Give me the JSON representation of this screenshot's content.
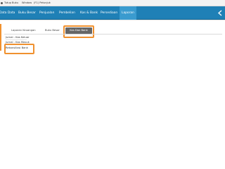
{
  "titlebar": {
    "items": [
      "Tutup Buku",
      "Window",
      "(F1) Petunjuk"
    ]
  },
  "nav": {
    "items": [
      "Data Data",
      "Buku Besar",
      "Penjualan",
      "Pembelian",
      "Kas & Bank",
      "Persediaan",
      "Laporan"
    ],
    "active": "Laporan"
  },
  "subnav": {
    "items": [
      "Laporan Keuangan",
      "Buku Besar"
    ],
    "active_label": "Kas Dan Bank"
  },
  "menu": {
    "items": [
      "Jurnal - Kas Keluar",
      "Jurnal - Kas Masuk",
      "Rekonsiliasi Bank"
    ],
    "highlighted": "Rekonsiliasi Bank"
  },
  "colors": {
    "navbar": "#1f80b6",
    "nav_active": "#3a9bcf",
    "highlight": "#f0912f",
    "subnav_active_bg": "#666666"
  },
  "icons": [
    "app-icon",
    "back-arrow-icon"
  ]
}
